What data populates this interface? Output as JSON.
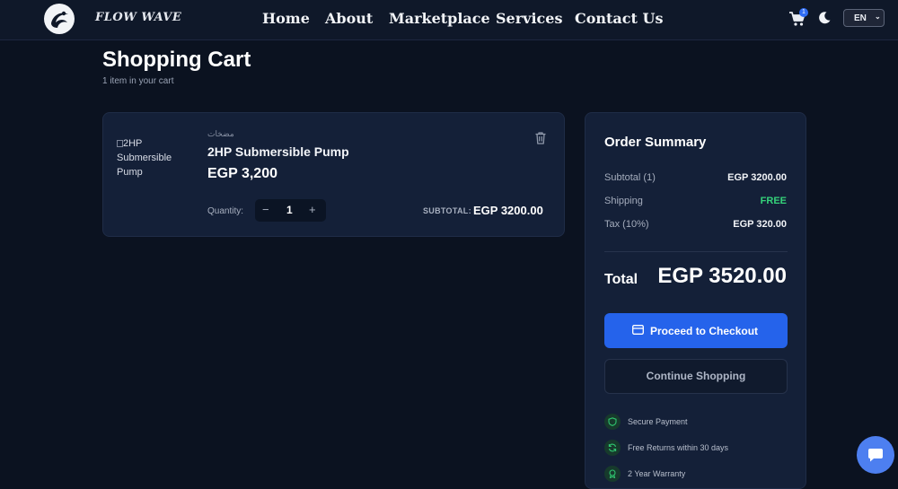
{
  "brand": {
    "name": "FLOW WAVE"
  },
  "nav": [
    "Home",
    "About",
    "Marketplace",
    "Services",
    "Contact Us"
  ],
  "header": {
    "cart_count": "1",
    "language": "EN"
  },
  "page": {
    "title": "Shopping Cart",
    "subtitle": "1 item in your cart"
  },
  "item": {
    "image_alt": "2HP Submersible Pump",
    "category": "مضخات",
    "name": "2HP Submersible Pump",
    "price": "EGP 3,200",
    "quantity_label": "Quantity:",
    "quantity": "1",
    "minus": "−",
    "plus": "+",
    "subtotal_label": "SUBTOTAL:",
    "subtotal": "EGP 3200.00"
  },
  "summary": {
    "title": "Order Summary",
    "rows": [
      {
        "label": "Subtotal (1)",
        "value": "EGP 3200.00"
      },
      {
        "label": "Shipping",
        "value": "FREE"
      },
      {
        "label": "Tax (10%)",
        "value": "EGP 320.00"
      }
    ],
    "total_label": "Total",
    "total_value": "EGP 3520.00",
    "checkout_label": "Proceed to Checkout",
    "continue_label": "Continue Shopping",
    "features": [
      "Secure Payment",
      "Free Returns within 30 days",
      "2 Year Warranty"
    ]
  },
  "colors": {
    "accent": "#2563eb",
    "success": "#35d27a",
    "background": "#0b1220",
    "card": "#142038"
  }
}
